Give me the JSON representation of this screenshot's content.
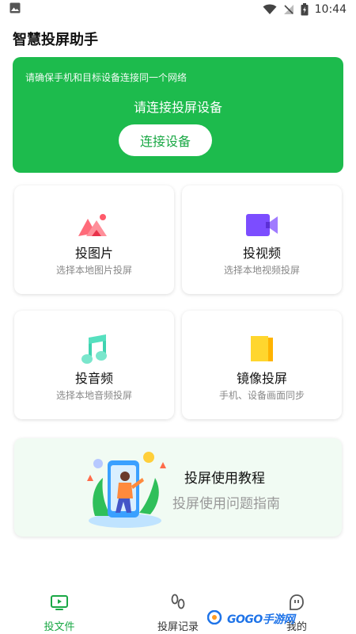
{
  "status": {
    "time": "10:44"
  },
  "app": {
    "title": "智慧投屏助手"
  },
  "banner": {
    "tip": "请确保手机和目标设备连接同一个网络",
    "prompt": "请连接投屏设备",
    "connect_label": "连接设备"
  },
  "cards": [
    {
      "title": "投图片",
      "subtitle": "选择本地图片投屏",
      "icon": "image-icon"
    },
    {
      "title": "投视频",
      "subtitle": "选择本地视频投屏",
      "icon": "video-icon"
    },
    {
      "title": "投音频",
      "subtitle": "选择本地音频投屏",
      "icon": "music-icon"
    },
    {
      "title": "镜像投屏",
      "subtitle": "手机、设备画面同步",
      "icon": "mirror-icon"
    }
  ],
  "tutorial": {
    "title": "投屏使用教程",
    "subtitle": "投屏使用问题指南"
  },
  "nav": [
    {
      "label": "投文件",
      "active": true
    },
    {
      "label": "投屏记录",
      "active": false
    },
    {
      "label": "我的",
      "active": false
    }
  ],
  "watermark": {
    "text": "GOGO手游网"
  },
  "colors": {
    "accent": "#1dbb4d",
    "accent_text": "#1aa845"
  }
}
